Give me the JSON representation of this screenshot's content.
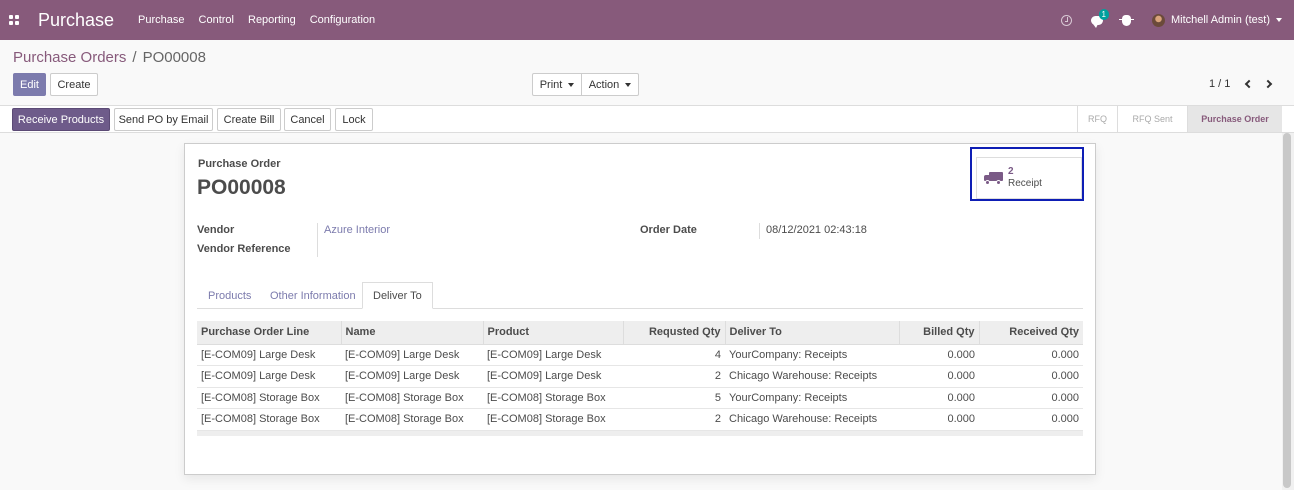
{
  "navbar": {
    "app_name": "Purchase",
    "menu": [
      "Purchase",
      "Control",
      "Reporting",
      "Configuration"
    ],
    "chat_count": "1",
    "user_name": "Mitchell Admin (test)",
    "background_color": "#875a7b"
  },
  "breadcrumb": {
    "parent": "Purchase Orders",
    "separator": "/",
    "current": "PO00008"
  },
  "controls": {
    "edit_label": "Edit",
    "create_label": "Create",
    "print_label": "Print",
    "action_label": "Action",
    "pager": "1 / 1"
  },
  "header_buttons": {
    "receive_products": "Receive Products",
    "send_po_email": "Send PO by Email",
    "create_bill": "Create Bill",
    "cancel": "Cancel",
    "lock": "Lock"
  },
  "statusbar": {
    "stages": [
      "RFQ",
      "RFQ Sent",
      "Purchase Order"
    ],
    "active": "Purchase Order"
  },
  "form": {
    "caption": "Purchase Order",
    "name": "PO00008",
    "smart_button": {
      "value": "2",
      "label": "Receipt",
      "icon": "truck-icon"
    },
    "vendor_label": "Vendor",
    "vendor_value": "Azure Interior",
    "vendor_ref_label": "Vendor Reference",
    "order_date_label": "Order Date",
    "order_date_value": "08/12/2021 02:43:18",
    "tabs": [
      "Products",
      "Other Information",
      "Deliver To"
    ],
    "active_tab": "Deliver To"
  },
  "table": {
    "columns": [
      "Purchase Order Line",
      "Name",
      "Product",
      "Requsted Qty",
      "Deliver To",
      "Billed Qty",
      "Received Qty"
    ],
    "rows": [
      [
        "[E-COM09] Large Desk",
        "[E-COM09] Large Desk",
        "[E-COM09] Large Desk",
        "4",
        "YourCompany: Receipts",
        "0.000",
        "0.000"
      ],
      [
        "[E-COM09] Large Desk",
        "[E-COM09] Large Desk",
        "[E-COM09] Large Desk",
        "2",
        "Chicago Warehouse: Receipts",
        "0.000",
        "0.000"
      ],
      [
        "[E-COM08] Storage Box",
        "[E-COM08] Storage Box",
        "[E-COM08] Storage Box",
        "5",
        "YourCompany: Receipts",
        "0.000",
        "0.000"
      ],
      [
        "[E-COM08] Storage Box",
        "[E-COM08] Storage Box",
        "[E-COM08] Storage Box",
        "2",
        "Chicago Warehouse: Receipts",
        "0.000",
        "0.000"
      ]
    ]
  }
}
